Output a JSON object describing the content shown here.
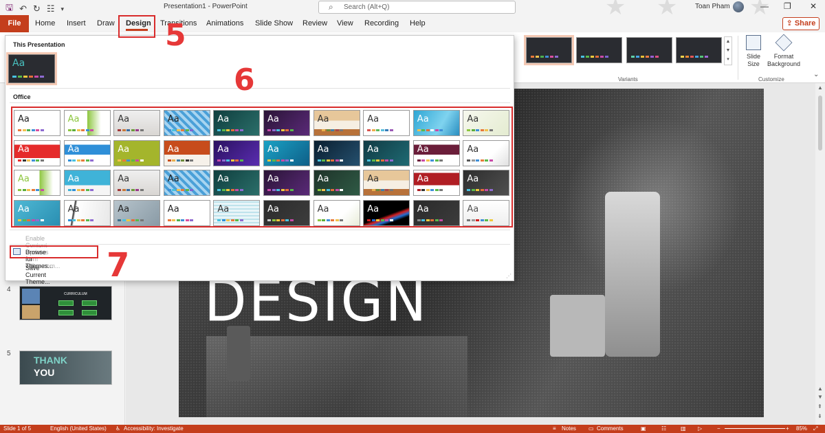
{
  "window": {
    "document_title": "Presentation1",
    "app_name": "PowerPoint",
    "title_separator": "-",
    "search_placeholder": "Search (Alt+Q)",
    "user_name": "Toan Pham"
  },
  "ribbon_tabs": [
    "File",
    "Home",
    "Insert",
    "Draw",
    "Design",
    "Transitions",
    "Animations",
    "Slide Show",
    "Review",
    "View",
    "Recording",
    "Help"
  ],
  "active_tab": "Design",
  "share_label": "Share",
  "ribbon": {
    "variants_label": "Variants",
    "customize_label": "Customize",
    "slide_size_label": "Slide Size",
    "format_background_label": "Format Background",
    "variant_colors": [
      [
        "#e8793a",
        "#f2c14e",
        "#4caf50",
        "#3f8fd8",
        "#d94fa0",
        "#8e6bd1"
      ],
      [
        "#49c2e0",
        "#59b94a",
        "#f0c93b",
        "#e46d3a",
        "#c94aa8",
        "#7d64cf"
      ],
      [
        "#5fd0a8",
        "#45a6e6",
        "#e8be36",
        "#ef7b42",
        "#9a5ed2",
        "#dd4f82"
      ],
      [
        "#f4d24b",
        "#ec8a35",
        "#e45656",
        "#47a3e0",
        "#56c47a",
        "#a06ad6"
      ]
    ]
  },
  "theme_dropdown": {
    "this_presentation_label": "This Presentation",
    "office_label": "Office",
    "enable_updates_label": "Enable Content Updates from Office.com...",
    "browse_label": "Browse for Themes...",
    "save_label": "Save Current Theme...",
    "current_theme_text": "Aa",
    "themes": [
      {
        "bg": "#ffffff",
        "fg": "#222222",
        "sw": [
          "#e8793a",
          "#f2c14e",
          "#4caf50",
          "#3f8fd8",
          "#d94fa0",
          "#8e6bd1"
        ]
      },
      {
        "bg": "linear-gradient(90deg,#ffffff 50%,#8dc63f 50%,#ffffff 80%)",
        "fg": "#8dc63f",
        "sw": [
          "#8dc63f",
          "#5cae3a",
          "#f2c14e",
          "#e8793a",
          "#3f8fd8",
          "#c94aa8"
        ]
      },
      {
        "bg": "linear-gradient(180deg,#efefef,#d9d6d3)",
        "fg": "#333333",
        "sw": [
          "#a23a3a",
          "#c8783a",
          "#3a6ea2",
          "#6a9a3a",
          "#9a3a8a",
          "#777777"
        ]
      },
      {
        "bg": "repeating-linear-gradient(45deg,#4aa0d8 0 4px,#a8d4f0 4px 8px)",
        "fg": "#222222",
        "sw": [
          "#3f8fd8",
          "#49c2e0",
          "#f2c14e",
          "#e8793a",
          "#59b94a",
          "#7d64cf"
        ]
      },
      {
        "bg": "linear-gradient(135deg,#0f3e3e,#2b6f6a)",
        "fg": "#ffffff",
        "sw": [
          "#49c2e0",
          "#59b94a",
          "#f0c93b",
          "#e46d3a",
          "#c94aa8",
          "#8e6bd1"
        ]
      },
      {
        "bg": "linear-gradient(135deg,#2a1436,#5a2a78)",
        "fg": "#ffffff",
        "sw": [
          "#c94aa8",
          "#8e6bd1",
          "#49c2e0",
          "#f0c93b",
          "#e46d3a",
          "#59b94a"
        ]
      },
      {
        "bg": "linear-gradient(180deg,#e7c79a 0 40%,#f6efe3 40% 75%,#b8723a 75%)",
        "fg": "#333333",
        "sw": [
          "#b8723a",
          "#e8b04e",
          "#6a8a3a",
          "#3f7fa8",
          "#a84a4a",
          "#777777"
        ]
      },
      {
        "bg": "#ffffff",
        "fg": "#333333",
        "sw": [
          "#d9534f",
          "#f0ad4e",
          "#5cb85c",
          "#5bc0de",
          "#337ab7",
          "#9b59b6"
        ]
      },
      {
        "bg": "linear-gradient(120deg,#2fa6d4,#7fd3ef 60%,#2a8ec0)",
        "fg": "#ffffff",
        "sw": [
          "#f2c14e",
          "#59b94a",
          "#e46d3a",
          "#ffffff",
          "#c94aa8",
          "#3f8fd8"
        ]
      },
      {
        "bg": "linear-gradient(135deg,#f7f8ee,#e4ecd1)",
        "fg": "#333333",
        "sw": [
          "#8dc63f",
          "#5cae3a",
          "#3f8fd8",
          "#e8793a",
          "#f2c14e",
          "#777777"
        ]
      },
      {
        "bg": "linear-gradient(180deg,#ffffff 15%,#e52b2b 15% 70%,#ffffff 70%)",
        "fg": "#ffffff",
        "sw": [
          "#e52b2b",
          "#333333",
          "#f2c14e",
          "#3f8fd8",
          "#59b94a",
          "#777777"
        ]
      },
      {
        "bg": "linear-gradient(180deg,#ffffff 15%,#2f8fd8 15% 55%,#ffffff 55%)",
        "fg": "#ffffff",
        "sw": [
          "#2f8fd8",
          "#49c2e0",
          "#f2c14e",
          "#e8793a",
          "#59b94a",
          "#8e6bd1"
        ]
      },
      {
        "bg": "#a4b52c",
        "fg": "#ffffff",
        "sw": [
          "#f2c14e",
          "#e8793a",
          "#3f8fd8",
          "#59b94a",
          "#c94aa8",
          "#ffffff"
        ]
      },
      {
        "bg": "linear-gradient(180deg,#c74c1c 0 55%,#f6f1ea 55%)",
        "fg": "#ffffff",
        "sw": [
          "#c74c1c",
          "#e8b04e",
          "#3f7fa8",
          "#6a8a3a",
          "#333333",
          "#777777"
        ]
      },
      {
        "bg": "linear-gradient(135deg,#2a1160,#5a2db0)",
        "fg": "#ffffff",
        "sw": [
          "#c94aa8",
          "#8e6bd1",
          "#49c2e0",
          "#f0c93b",
          "#e46d3a",
          "#59b94a"
        ]
      },
      {
        "bg": "linear-gradient(135deg,#1aa1c4,#0f5f88)",
        "fg": "#ffffff",
        "sw": [
          "#f0c93b",
          "#59b94a",
          "#e46d3a",
          "#c94aa8",
          "#8e6bd1",
          "#ffffff"
        ]
      },
      {
        "bg": "linear-gradient(135deg,#0a1e2f,#25506e)",
        "fg": "#ffffff",
        "sw": [
          "#49c2e0",
          "#59b94a",
          "#f0c93b",
          "#e46d3a",
          "#c94aa8",
          "#ffffff"
        ]
      },
      {
        "bg": "linear-gradient(135deg,#113b44,#1f6a73)",
        "fg": "#ffffff",
        "sw": [
          "#49c2e0",
          "#59b94a",
          "#f0c93b",
          "#e46d3a",
          "#c94aa8",
          "#8e6bd1"
        ]
      },
      {
        "bg": "linear-gradient(180deg,#ffffff 15%,#6b1e3a 15% 55%,#ffffff 55%)",
        "fg": "#ffffff",
        "sw": [
          "#6b1e3a",
          "#c94aa8",
          "#f2c14e",
          "#3f8fd8",
          "#59b94a",
          "#777777"
        ]
      },
      {
        "bg": "linear-gradient(135deg,#ffffff 60%,#e0e0e0)",
        "fg": "#333333",
        "sw": [
          "#555555",
          "#999999",
          "#3f8fd8",
          "#e8793a",
          "#59b94a",
          "#c94aa8"
        ]
      },
      {
        "bg": "linear-gradient(90deg,#ffffff 55%,#8dc63f 55%,#ffffff 85%)",
        "fg": "#8dc63f",
        "sw": [
          "#8dc63f",
          "#5cae3a",
          "#f2c14e",
          "#e8793a",
          "#3f8fd8",
          "#c94aa8"
        ]
      },
      {
        "bg": "linear-gradient(180deg,#3fb3d8 0 60%,#f5f5f5 60%)",
        "fg": "#ffffff",
        "sw": [
          "#3fb3d8",
          "#2f8fd8",
          "#f2c14e",
          "#e8793a",
          "#59b94a",
          "#8e6bd1"
        ]
      },
      {
        "bg": "linear-gradient(180deg,#efefef,#d9d6d3)",
        "fg": "#333333",
        "sw": [
          "#a23a3a",
          "#c8783a",
          "#3a6ea2",
          "#6a9a3a",
          "#9a3a8a",
          "#777777"
        ]
      },
      {
        "bg": "repeating-linear-gradient(45deg,#4aa0d8 0 4px,#a8d4f0 4px 8px)",
        "fg": "#222222",
        "sw": [
          "#3f8fd8",
          "#49c2e0",
          "#f2c14e",
          "#e8793a",
          "#59b94a",
          "#7d64cf"
        ]
      },
      {
        "bg": "linear-gradient(135deg,#0f3e3e,#2b6f6a)",
        "fg": "#ffffff",
        "sw": [
          "#49c2e0",
          "#59b94a",
          "#f0c93b",
          "#e46d3a",
          "#c94aa8",
          "#8e6bd1"
        ]
      },
      {
        "bg": "linear-gradient(135deg,#2a1436,#5a2a78)",
        "fg": "#ffffff",
        "sw": [
          "#c94aa8",
          "#8e6bd1",
          "#49c2e0",
          "#f0c93b",
          "#e46d3a",
          "#59b94a"
        ]
      },
      {
        "bg": "linear-gradient(135deg,#1e3329,#2f5a45)",
        "fg": "#ffffff",
        "sw": [
          "#8dc63f",
          "#f2c14e",
          "#49c2e0",
          "#e46d3a",
          "#c94aa8",
          "#ffffff"
        ]
      },
      {
        "bg": "linear-gradient(180deg,#e7c79a 0 40%,#f6efe3 40% 75%,#b8723a 75%)",
        "fg": "#333333",
        "sw": [
          "#b8723a",
          "#e8b04e",
          "#6a8a3a",
          "#3f7fa8",
          "#a84a4a",
          "#777777"
        ]
      },
      {
        "bg": "linear-gradient(180deg,#ffffff 10%,#b01e24 10% 60%,#ffffff 60%)",
        "fg": "#ffffff",
        "sw": [
          "#b01e24",
          "#333333",
          "#f2c14e",
          "#3f8fd8",
          "#59b94a",
          "#777777"
        ]
      },
      {
        "bg": "linear-gradient(135deg,#2d2d2d,#505050)",
        "fg": "#ffffff",
        "sw": [
          "#49c2e0",
          "#59b94a",
          "#f0c93b",
          "#e46d3a",
          "#c94aa8",
          "#8e6bd1"
        ]
      },
      {
        "bg": "linear-gradient(135deg,#4fb8d4,#2a8fb2)",
        "fg": "#ffffff",
        "sw": [
          "#f0c93b",
          "#59b94a",
          "#e46d3a",
          "#c94aa8",
          "#8e6bd1",
          "#ffffff"
        ]
      },
      {
        "bg": "linear-gradient(100deg,#ffffff 20%,#2a2a2a 22%,#ffffff 26%,#e8e8e8)",
        "fg": "#333333",
        "sw": [
          "#2f8fd8",
          "#49c2e0",
          "#f2c14e",
          "#e8793a",
          "#59b94a",
          "#8e6bd1"
        ]
      },
      {
        "bg": "linear-gradient(135deg,#b7c4cc,#8a9ba6)",
        "fg": "#222222",
        "sw": [
          "#3f6e8a",
          "#49c2e0",
          "#f0c93b",
          "#e46d3a",
          "#59b94a",
          "#777777"
        ]
      },
      {
        "bg": "#ffffff",
        "fg": "#222222",
        "sw": [
          "#e8793a",
          "#f2c14e",
          "#4caf50",
          "#3f8fd8",
          "#d94fa0",
          "#8e6bd1"
        ]
      },
      {
        "bg": "repeating-linear-gradient(0deg,#e9f5f8 0 3px,#bfe3ec 3px 5px)",
        "fg": "#333333",
        "sw": [
          "#49c2e0",
          "#2f8fd8",
          "#f2c14e",
          "#e8793a",
          "#59b94a",
          "#8e6bd1"
        ]
      },
      {
        "bg": "linear-gradient(135deg,#2b2b2b,#3d3d3d)",
        "fg": "#ffffff",
        "sw": [
          "#c8c8c8",
          "#8dc63f",
          "#f0c93b",
          "#e46d3a",
          "#49c2e0",
          "#c94aa8"
        ]
      },
      {
        "bg": "linear-gradient(135deg,#ffffff 60%,#e8ecd8)",
        "fg": "#333333",
        "sw": [
          "#8dc63f",
          "#5cae3a",
          "#3f8fd8",
          "#e8793a",
          "#f2c14e",
          "#777777"
        ]
      },
      {
        "bg": "linear-gradient(160deg,#000000 55%,#d21f1f 62%,#1f6fd2 70%,#000000 78%)",
        "fg": "#ffffff",
        "sw": [
          "#d21f1f",
          "#1f6fd2",
          "#f0c93b",
          "#59b94a",
          "#c94aa8",
          "#ffffff"
        ]
      },
      {
        "bg": "linear-gradient(135deg,#2a2a2a,#3c3c3c)",
        "fg": "#ffffff",
        "sw": [
          "#8a8a8a",
          "#49c2e0",
          "#f0c93b",
          "#e46d3a",
          "#59b94a",
          "#c94aa8"
        ]
      },
      {
        "bg": "linear-gradient(180deg,#ffffff,#eeeeee)",
        "fg": "#555555",
        "sw": [
          "#777777",
          "#999999",
          "#d21f1f",
          "#3f8fd8",
          "#59b94a",
          "#f0c93b"
        ]
      }
    ]
  },
  "slides": {
    "slide4_number": "4",
    "slide5_number": "5",
    "slide4_title": "CURRICULUM",
    "slide5_line1": "THANK",
    "slide5_line2": "YOU"
  },
  "main_slide": {
    "title_text": "DESIGN"
  },
  "statusbar": {
    "slide_info": "Slide 1 of 5",
    "language": "English (United States)",
    "accessibility": "Accessibility: Investigate",
    "notes": "Notes",
    "comments": "Comments",
    "zoom": "85%"
  },
  "annotations": {
    "step5": "5",
    "step6": "6",
    "step7": "7"
  },
  "colors": {
    "accent": "#c43e1c",
    "annotation_red": "#d82a2a"
  }
}
